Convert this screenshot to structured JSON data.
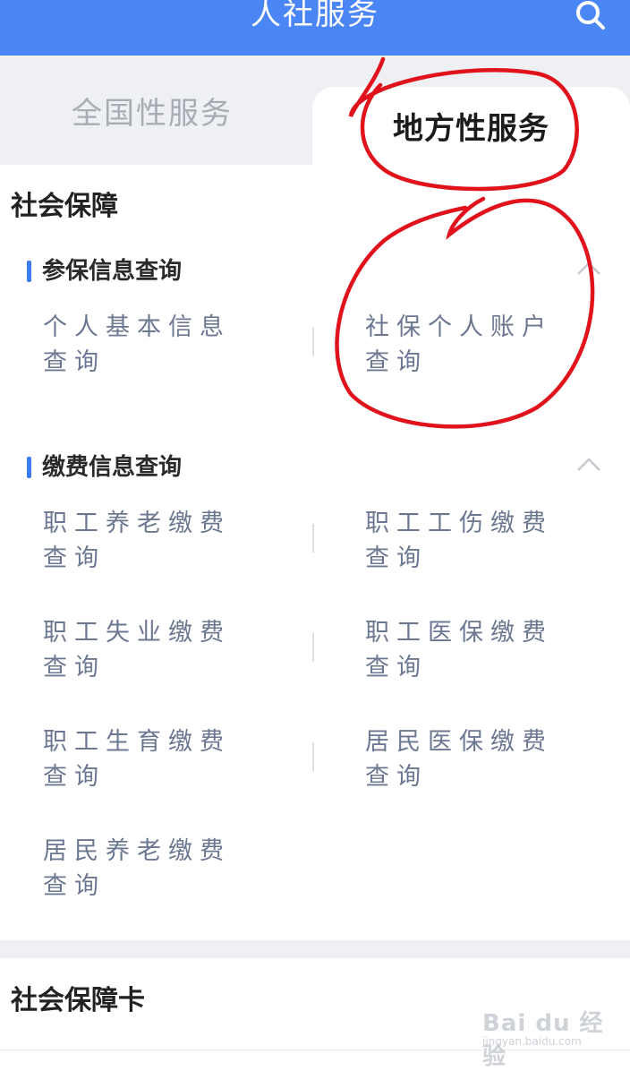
{
  "header": {
    "title": "人社服务"
  },
  "tabs": [
    {
      "label": "全国性服务",
      "active": false
    },
    {
      "label": "地方性服务",
      "active": true
    }
  ],
  "sections": [
    {
      "title": "社会保障",
      "groups": [
        {
          "title": "参保信息查询",
          "items": [
            [
              "个人基本信息",
              "查询"
            ],
            [
              "社保个人账户",
              "查询"
            ]
          ]
        },
        {
          "title": "缴费信息查询",
          "items": [
            [
              "职工养老缴费",
              "查询"
            ],
            [
              "职工工伤缴费",
              "查询"
            ],
            [
              "职工失业缴费",
              "查询"
            ],
            [
              "职工医保缴费",
              "查询"
            ],
            [
              "职工生育缴费",
              "查询"
            ],
            [
              "居民医保缴费",
              "查询"
            ],
            [
              "居民养老缴费",
              "查询"
            ]
          ]
        }
      ]
    },
    {
      "title": "社会保障卡"
    }
  ],
  "watermark": {
    "main": "Bai du 经验",
    "sub": "jingyan.baidu.com"
  },
  "colors": {
    "brand": "#4a86f5",
    "accent": "#3d7bf2",
    "item_text": "#6c7891",
    "annotation": "#e0121b"
  }
}
